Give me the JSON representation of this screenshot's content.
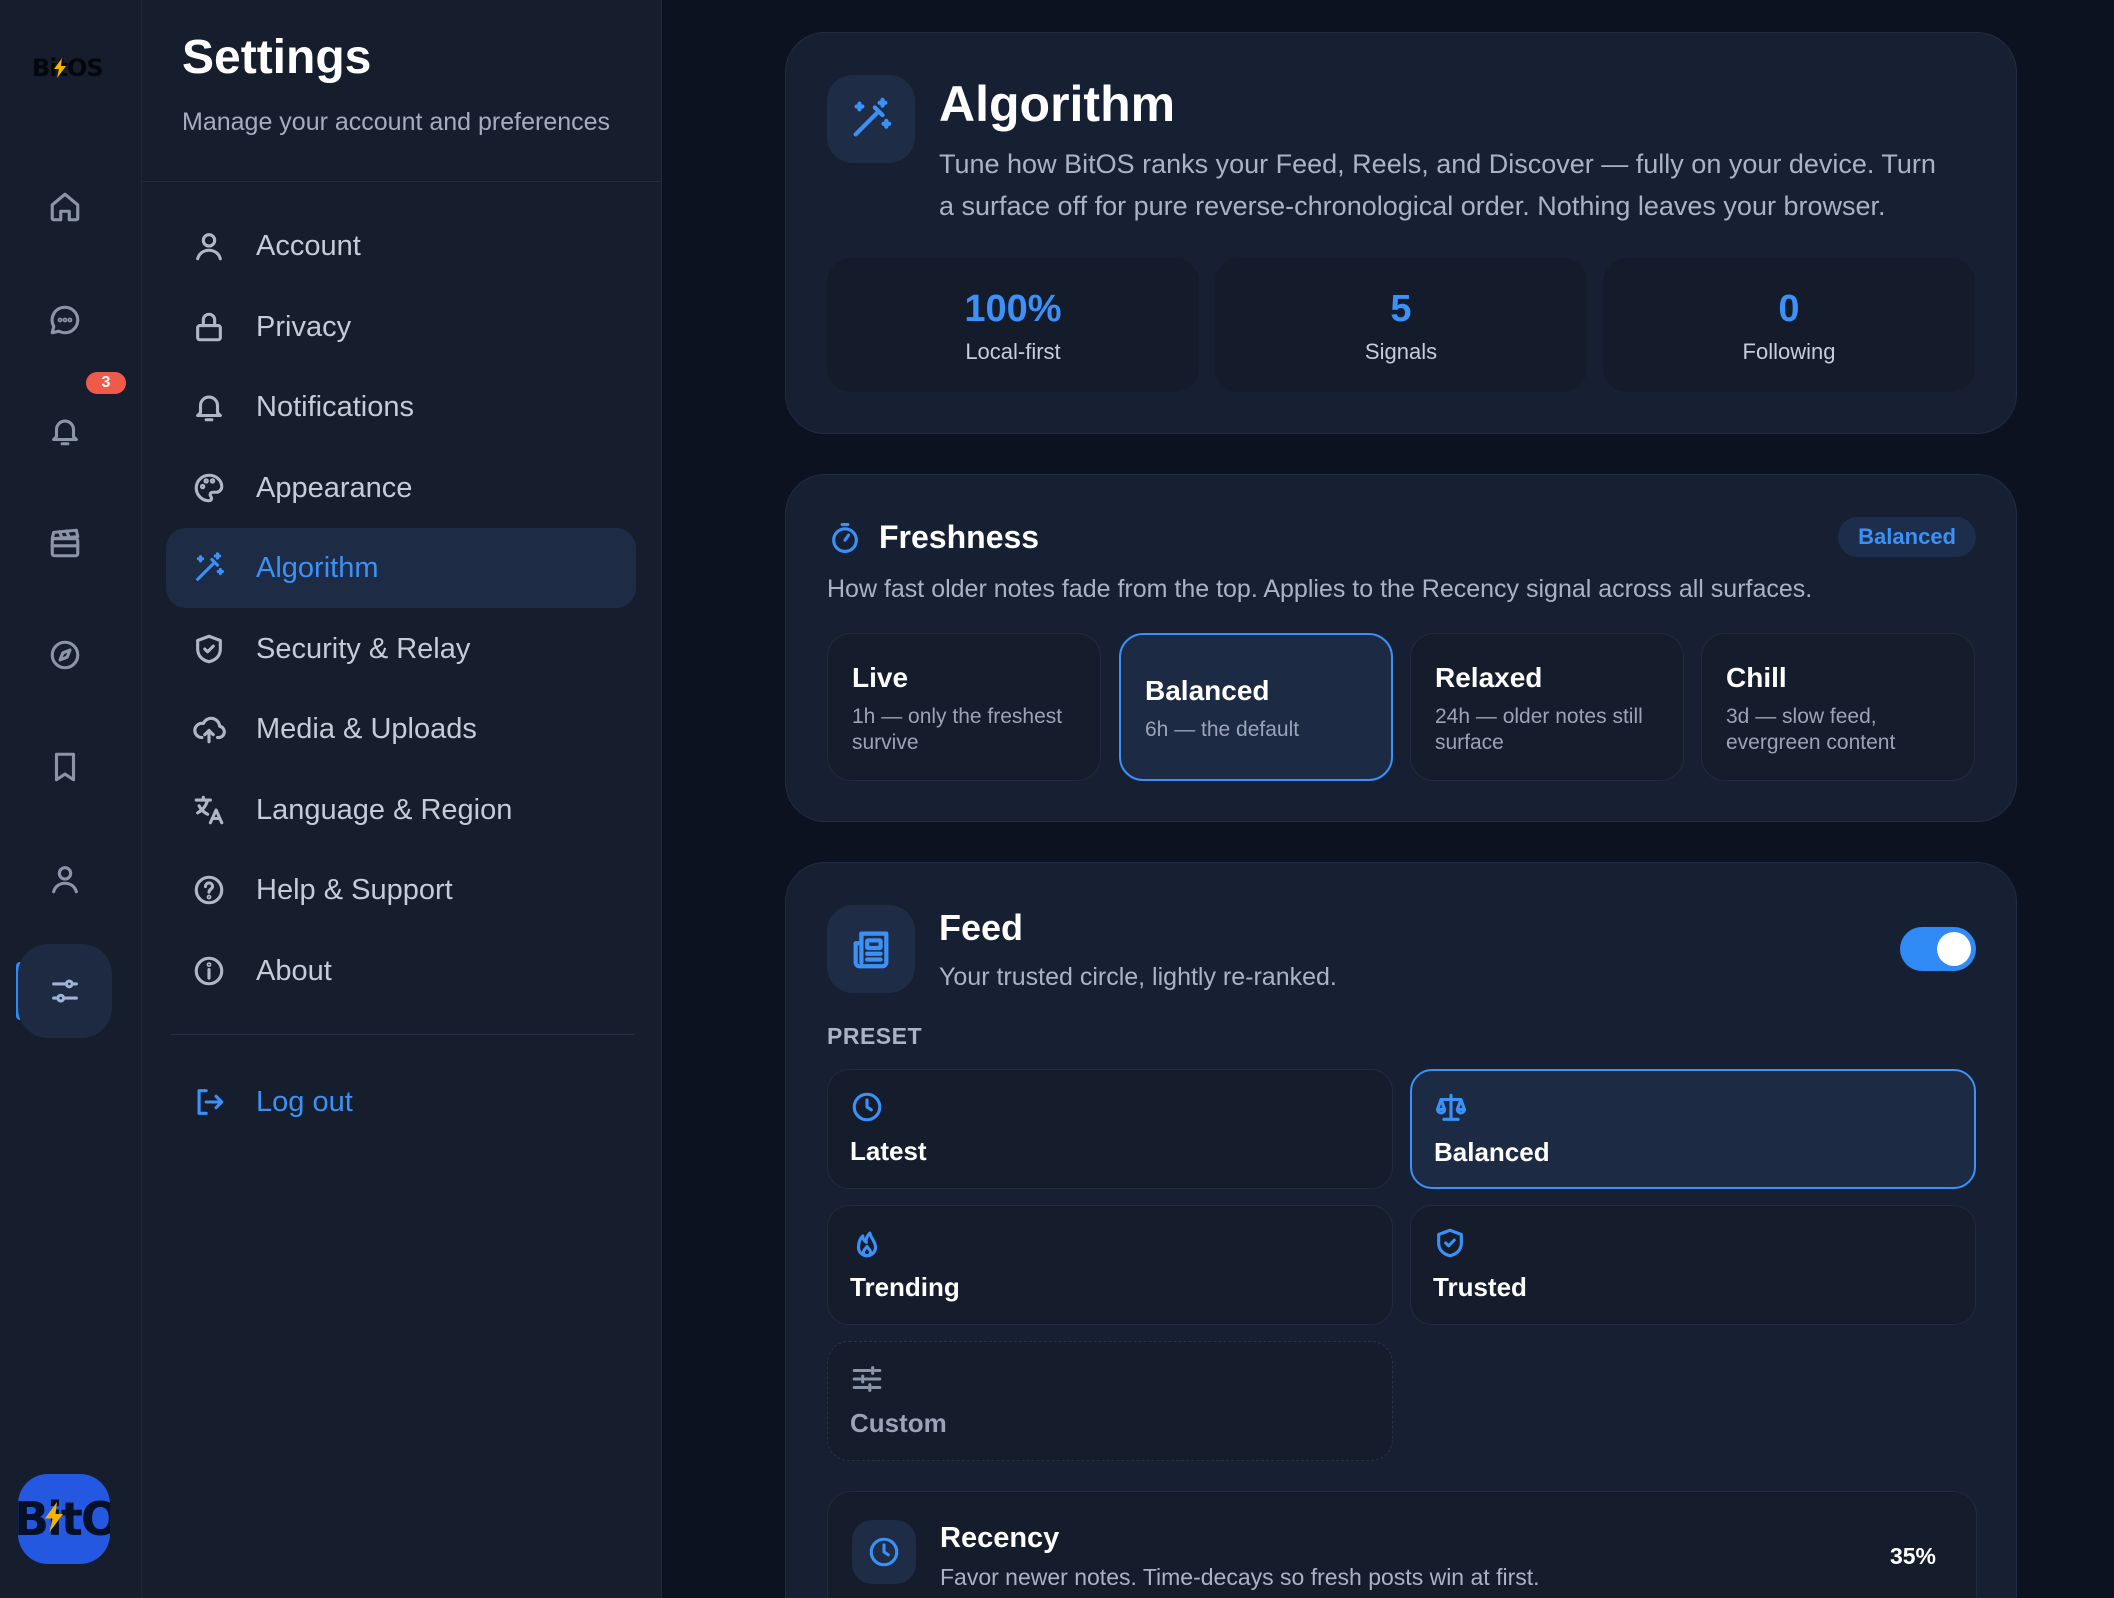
{
  "rail": {
    "logo_text": "BitOS",
    "badge_count": "3",
    "avatar_text": "BitOS",
    "items": [
      {
        "icon": "home-icon"
      },
      {
        "icon": "chat-icon"
      },
      {
        "icon": "bell-icon"
      },
      {
        "icon": "clapperboard-icon"
      },
      {
        "icon": "compass-icon"
      },
      {
        "icon": "bookmark-icon"
      },
      {
        "icon": "user-icon"
      },
      {
        "icon": "sliders-icon",
        "active": true
      }
    ]
  },
  "settings": {
    "title": "Settings",
    "subtitle": "Manage your account and preferences",
    "nav": [
      {
        "label": "Account",
        "icon": "user-icon"
      },
      {
        "label": "Privacy",
        "icon": "lock-icon"
      },
      {
        "label": "Notifications",
        "icon": "bell-icon"
      },
      {
        "label": "Appearance",
        "icon": "palette-icon"
      },
      {
        "label": "Algorithm",
        "icon": "magic-wand-icon",
        "active": true
      },
      {
        "label": "Security & Relay",
        "icon": "shield-icon"
      },
      {
        "label": "Media & Uploads",
        "icon": "cloud-upload-icon"
      },
      {
        "label": "Language & Region",
        "icon": "translate-icon"
      },
      {
        "label": "Help & Support",
        "icon": "help-icon"
      },
      {
        "label": "About",
        "icon": "info-icon"
      }
    ],
    "logout": "Log out"
  },
  "algorithm": {
    "title": "Algorithm",
    "description": "Tune how BitOS ranks your Feed, Reels, and Discover — fully on your device. Turn a surface off for pure reverse-chronological order. Nothing leaves your browser.",
    "stats": [
      {
        "value": "100%",
        "label": "Local-first"
      },
      {
        "value": "5",
        "label": "Signals"
      },
      {
        "value": "0",
        "label": "Following"
      }
    ]
  },
  "freshness": {
    "title": "Freshness",
    "badge": "Balanced",
    "description": "How fast older notes fade from the top. Applies to the Recency signal across all surfaces.",
    "options": [
      {
        "name": "Live",
        "sub": "1h — only the freshest survive"
      },
      {
        "name": "Balanced",
        "sub": "6h — the default",
        "selected": true
      },
      {
        "name": "Relaxed",
        "sub": "24h — older notes still surface"
      },
      {
        "name": "Chill",
        "sub": "3d — slow feed, evergreen content"
      }
    ]
  },
  "feed": {
    "title": "Feed",
    "subtitle": "Your trusted circle, lightly re-ranked.",
    "enabled": true,
    "preset_label": "PRESET",
    "presets": [
      {
        "name": "Latest",
        "icon": "clock-icon"
      },
      {
        "name": "Balanced",
        "icon": "scale-icon",
        "selected": true
      },
      {
        "name": "Trending",
        "icon": "flame-icon"
      },
      {
        "name": "Trusted",
        "icon": "shield-check-icon"
      },
      {
        "name": "Custom",
        "icon": "sliders-icon"
      }
    ],
    "signal": {
      "name": "Recency",
      "description": "Favor newer notes. Time-decays so fresh posts win at first.",
      "value": "35%"
    }
  },
  "colors": {
    "accent": "#3b91f7",
    "background": "#0c1220",
    "panel": "#161d2c",
    "card": "#172033",
    "badge": "#ef5a4a"
  }
}
